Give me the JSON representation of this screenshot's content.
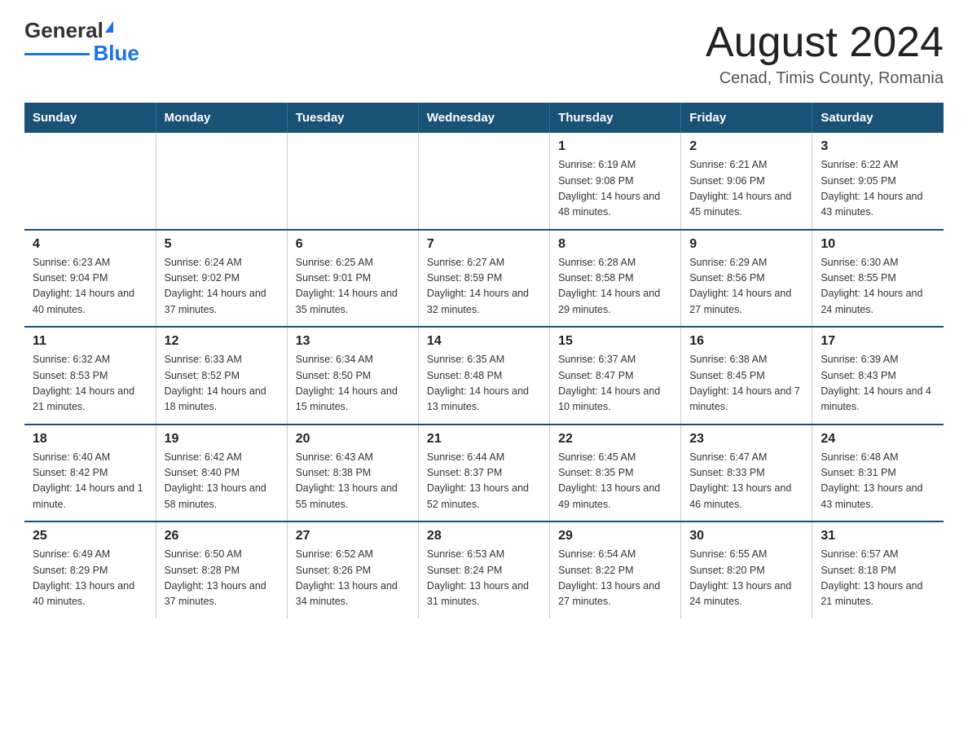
{
  "logo": {
    "text_general": "General",
    "text_blue": "Blue"
  },
  "header": {
    "title": "August 2024",
    "subtitle": "Cenad, Timis County, Romania"
  },
  "days_of_week": [
    "Sunday",
    "Monday",
    "Tuesday",
    "Wednesday",
    "Thursday",
    "Friday",
    "Saturday"
  ],
  "weeks": [
    [
      {
        "day": "",
        "info": ""
      },
      {
        "day": "",
        "info": ""
      },
      {
        "day": "",
        "info": ""
      },
      {
        "day": "",
        "info": ""
      },
      {
        "day": "1",
        "info": "Sunrise: 6:19 AM\nSunset: 9:08 PM\nDaylight: 14 hours and 48 minutes."
      },
      {
        "day": "2",
        "info": "Sunrise: 6:21 AM\nSunset: 9:06 PM\nDaylight: 14 hours and 45 minutes."
      },
      {
        "day": "3",
        "info": "Sunrise: 6:22 AM\nSunset: 9:05 PM\nDaylight: 14 hours and 43 minutes."
      }
    ],
    [
      {
        "day": "4",
        "info": "Sunrise: 6:23 AM\nSunset: 9:04 PM\nDaylight: 14 hours and 40 minutes."
      },
      {
        "day": "5",
        "info": "Sunrise: 6:24 AM\nSunset: 9:02 PM\nDaylight: 14 hours and 37 minutes."
      },
      {
        "day": "6",
        "info": "Sunrise: 6:25 AM\nSunset: 9:01 PM\nDaylight: 14 hours and 35 minutes."
      },
      {
        "day": "7",
        "info": "Sunrise: 6:27 AM\nSunset: 8:59 PM\nDaylight: 14 hours and 32 minutes."
      },
      {
        "day": "8",
        "info": "Sunrise: 6:28 AM\nSunset: 8:58 PM\nDaylight: 14 hours and 29 minutes."
      },
      {
        "day": "9",
        "info": "Sunrise: 6:29 AM\nSunset: 8:56 PM\nDaylight: 14 hours and 27 minutes."
      },
      {
        "day": "10",
        "info": "Sunrise: 6:30 AM\nSunset: 8:55 PM\nDaylight: 14 hours and 24 minutes."
      }
    ],
    [
      {
        "day": "11",
        "info": "Sunrise: 6:32 AM\nSunset: 8:53 PM\nDaylight: 14 hours and 21 minutes."
      },
      {
        "day": "12",
        "info": "Sunrise: 6:33 AM\nSunset: 8:52 PM\nDaylight: 14 hours and 18 minutes."
      },
      {
        "day": "13",
        "info": "Sunrise: 6:34 AM\nSunset: 8:50 PM\nDaylight: 14 hours and 15 minutes."
      },
      {
        "day": "14",
        "info": "Sunrise: 6:35 AM\nSunset: 8:48 PM\nDaylight: 14 hours and 13 minutes."
      },
      {
        "day": "15",
        "info": "Sunrise: 6:37 AM\nSunset: 8:47 PM\nDaylight: 14 hours and 10 minutes."
      },
      {
        "day": "16",
        "info": "Sunrise: 6:38 AM\nSunset: 8:45 PM\nDaylight: 14 hours and 7 minutes."
      },
      {
        "day": "17",
        "info": "Sunrise: 6:39 AM\nSunset: 8:43 PM\nDaylight: 14 hours and 4 minutes."
      }
    ],
    [
      {
        "day": "18",
        "info": "Sunrise: 6:40 AM\nSunset: 8:42 PM\nDaylight: 14 hours and 1 minute."
      },
      {
        "day": "19",
        "info": "Sunrise: 6:42 AM\nSunset: 8:40 PM\nDaylight: 13 hours and 58 minutes."
      },
      {
        "day": "20",
        "info": "Sunrise: 6:43 AM\nSunset: 8:38 PM\nDaylight: 13 hours and 55 minutes."
      },
      {
        "day": "21",
        "info": "Sunrise: 6:44 AM\nSunset: 8:37 PM\nDaylight: 13 hours and 52 minutes."
      },
      {
        "day": "22",
        "info": "Sunrise: 6:45 AM\nSunset: 8:35 PM\nDaylight: 13 hours and 49 minutes."
      },
      {
        "day": "23",
        "info": "Sunrise: 6:47 AM\nSunset: 8:33 PM\nDaylight: 13 hours and 46 minutes."
      },
      {
        "day": "24",
        "info": "Sunrise: 6:48 AM\nSunset: 8:31 PM\nDaylight: 13 hours and 43 minutes."
      }
    ],
    [
      {
        "day": "25",
        "info": "Sunrise: 6:49 AM\nSunset: 8:29 PM\nDaylight: 13 hours and 40 minutes."
      },
      {
        "day": "26",
        "info": "Sunrise: 6:50 AM\nSunset: 8:28 PM\nDaylight: 13 hours and 37 minutes."
      },
      {
        "day": "27",
        "info": "Sunrise: 6:52 AM\nSunset: 8:26 PM\nDaylight: 13 hours and 34 minutes."
      },
      {
        "day": "28",
        "info": "Sunrise: 6:53 AM\nSunset: 8:24 PM\nDaylight: 13 hours and 31 minutes."
      },
      {
        "day": "29",
        "info": "Sunrise: 6:54 AM\nSunset: 8:22 PM\nDaylight: 13 hours and 27 minutes."
      },
      {
        "day": "30",
        "info": "Sunrise: 6:55 AM\nSunset: 8:20 PM\nDaylight: 13 hours and 24 minutes."
      },
      {
        "day": "31",
        "info": "Sunrise: 6:57 AM\nSunset: 8:18 PM\nDaylight: 13 hours and 21 minutes."
      }
    ]
  ]
}
